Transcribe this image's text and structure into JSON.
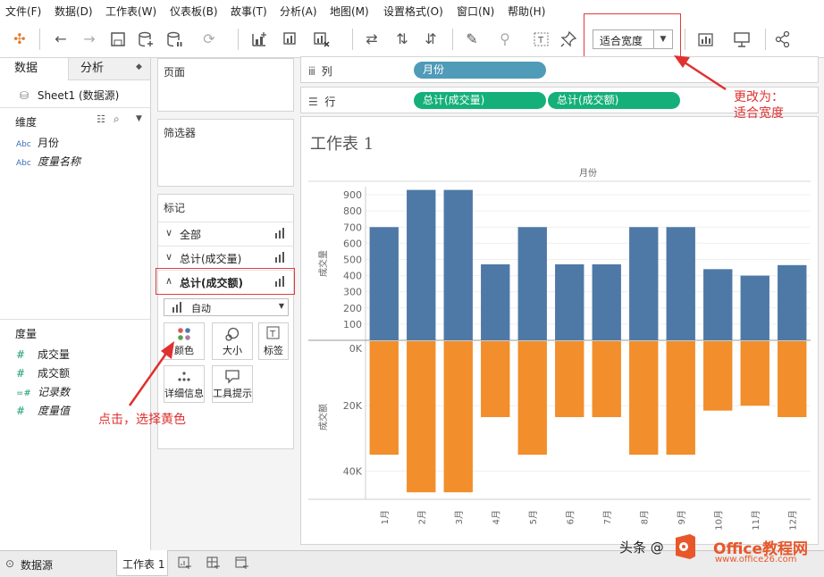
{
  "menu": [
    "文件(F)",
    "数据(D)",
    "工作表(W)",
    "仪表板(B)",
    "故事(T)",
    "分析(A)",
    "地图(M)",
    "设置格式(O)",
    "窗口(N)",
    "帮助(H)"
  ],
  "toolbar": {
    "fit_value": "适合宽度"
  },
  "left_pane": {
    "tabs": [
      "数据",
      "分析"
    ],
    "datasource": "Sheet1 (数据源)",
    "dimensions_title": "维度",
    "dimensions": [
      {
        "type": "Abc",
        "name": "月份"
      },
      {
        "type": "Abc",
        "name": "度量名称"
      }
    ],
    "measures_title": "度量",
    "measures": [
      {
        "type": "#",
        "name": "成交量"
      },
      {
        "type": "#",
        "name": "成交额"
      },
      {
        "type": "=#",
        "name": "记录数"
      },
      {
        "type": "#",
        "name": "度量值"
      }
    ]
  },
  "cards": {
    "pages": "页面",
    "filters": "筛选器",
    "marks": "标记",
    "mark_rows": [
      "全部",
      "总计(成交量)",
      "总计(成交额)"
    ],
    "mark_type": "自动",
    "mark_buttons": [
      "颜色",
      "大小",
      "标签",
      "详细信息",
      "工具提示"
    ]
  },
  "shelves": {
    "columns_label": "列",
    "rows_label": "行",
    "column_pills": [
      "月份"
    ],
    "row_pills": [
      "总计(成交量)",
      "总计(成交额)"
    ]
  },
  "sheet_title": "工作表 1",
  "colors": {
    "volume": "#4e79a7",
    "amount": "#f28e2b",
    "pill_blue": "#4f9bb8",
    "pill_green": "#15b07a",
    "annotation": "#e03030"
  },
  "chart_data": {
    "type": "bar",
    "header": "月份",
    "categories": [
      "1月",
      "2月",
      "3月",
      "4月",
      "5月",
      "6月",
      "7月",
      "8月",
      "9月",
      "10月",
      "11月",
      "12月"
    ],
    "series": [
      {
        "name": "成交量",
        "values": [
          700,
          930,
          930,
          470,
          700,
          470,
          470,
          700,
          700,
          440,
          400,
          465
        ],
        "ylim": [
          0,
          950
        ],
        "ticks": [
          100,
          200,
          300,
          400,
          500,
          600,
          700,
          800,
          900
        ],
        "tick_labels": [
          "100",
          "200",
          "300",
          "400",
          "500",
          "600",
          "700",
          "800",
          "900"
        ]
      },
      {
        "name": "成交额",
        "values": [
          35000,
          46500,
          46500,
          23500,
          35000,
          23500,
          23500,
          35000,
          35000,
          21500,
          20000,
          23500
        ],
        "ylim": [
          0,
          47000
        ],
        "ticks": [
          0,
          20000,
          40000
        ],
        "tick_labels": [
          "0K",
          "20K",
          "40K"
        ]
      }
    ]
  },
  "annotations": {
    "fit": "更改为：\n适合宽度",
    "color": "点击，选择黄色"
  },
  "status": {
    "datasource_tab": "数据源",
    "sheet_tab": "工作表 1"
  },
  "watermark": {
    "left": "头条 @",
    "brand": "Office教程网",
    "url": "www.office26.com"
  }
}
